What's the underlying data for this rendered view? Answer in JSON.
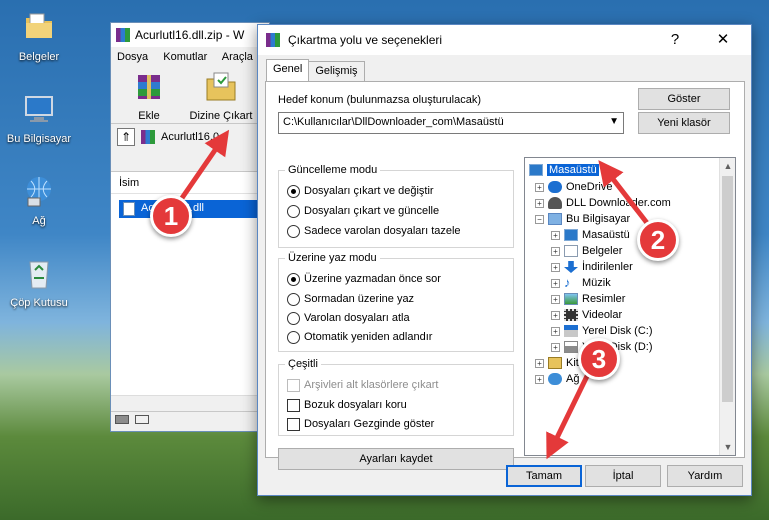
{
  "desktop": {
    "icons": [
      {
        "label": "Belgeler",
        "icon": "folder-documents-icon"
      },
      {
        "label": "Bu Bilgisayar",
        "icon": "computer-icon"
      },
      {
        "label": "Ağ",
        "icon": "network-icon"
      },
      {
        "label": "Çöp Kutusu",
        "icon": "recycle-bin-icon"
      }
    ]
  },
  "winrar": {
    "title": "Acurlutl16.dll.zip - W",
    "menu": [
      "Dosya",
      "Komutlar",
      "Araçla"
    ],
    "tools": {
      "add": "Ekle",
      "extract_to": "Dizine Çıkart"
    },
    "path": "Acurlutl16.0",
    "list_header": "İsim",
    "file_name": "Acurlutl16.dll"
  },
  "dialog": {
    "title": "Çıkartma yolu ve seçenekleri",
    "help": "?",
    "close": "✕",
    "tabs": [
      "Genel",
      "Gelişmiş"
    ],
    "dest_label": "Hedef konum (bulunmazsa oluşturulacak)",
    "dest_value": "C:\\Kullanıcılar\\DllDownloader_com\\Masaüstü",
    "show_button": "Göster",
    "new_folder_button": "Yeni klasör",
    "update_mode": {
      "title": "Güncelleme modu",
      "options": [
        "Dosyaları çıkart ve değiştir",
        "Dosyaları çıkart ve güncelle",
        "Sadece varolan dosyaları tazele"
      ]
    },
    "overwrite_mode": {
      "title": "Üzerine yaz modu",
      "options": [
        "Üzerine yazmadan önce sor",
        "Sormadan üzerine yaz",
        "Varolan dosyaları atla",
        "Otomatik yeniden adlandır"
      ]
    },
    "misc": {
      "title": "Çeşitli",
      "options": [
        "Arşivleri alt klasörlere çıkart",
        "Bozuk dosyaları koru",
        "Dosyaları Gezginde göster"
      ]
    },
    "save_settings": "Ayarları kaydet",
    "tree": [
      {
        "label": "Masaüstü",
        "icon": "desktop-icon"
      },
      {
        "label": "OneDrive",
        "icon": "onedrive-icon"
      },
      {
        "label": "DLL Downloader.com",
        "icon": "user-icon"
      },
      {
        "label": "Bu Bilgisayar",
        "icon": "computer-icon"
      },
      {
        "label": "Masaüstü",
        "icon": "desktop-icon"
      },
      {
        "label": "Belgeler",
        "icon": "documents-icon"
      },
      {
        "label": "İndirilenler",
        "icon": "download-icon"
      },
      {
        "label": "Müzik",
        "icon": "music-icon"
      },
      {
        "label": "Resimler",
        "icon": "pictures-icon"
      },
      {
        "label": "Videolar",
        "icon": "videos-icon"
      },
      {
        "label": "Yerel Disk (C:)",
        "icon": "drive-icon"
      },
      {
        "label": "Yerel Disk (D:)",
        "icon": "drive-icon"
      },
      {
        "label": "Kitaplıklar",
        "icon": "library-icon"
      },
      {
        "label": "Ağ",
        "icon": "network-icon"
      }
    ],
    "ok": "Tamam",
    "cancel": "İptal",
    "help_button": "Yardım"
  },
  "annotations": [
    "1",
    "2",
    "3"
  ],
  "colors": {
    "accent": "#0a64d6",
    "badge": "#e4393a"
  }
}
